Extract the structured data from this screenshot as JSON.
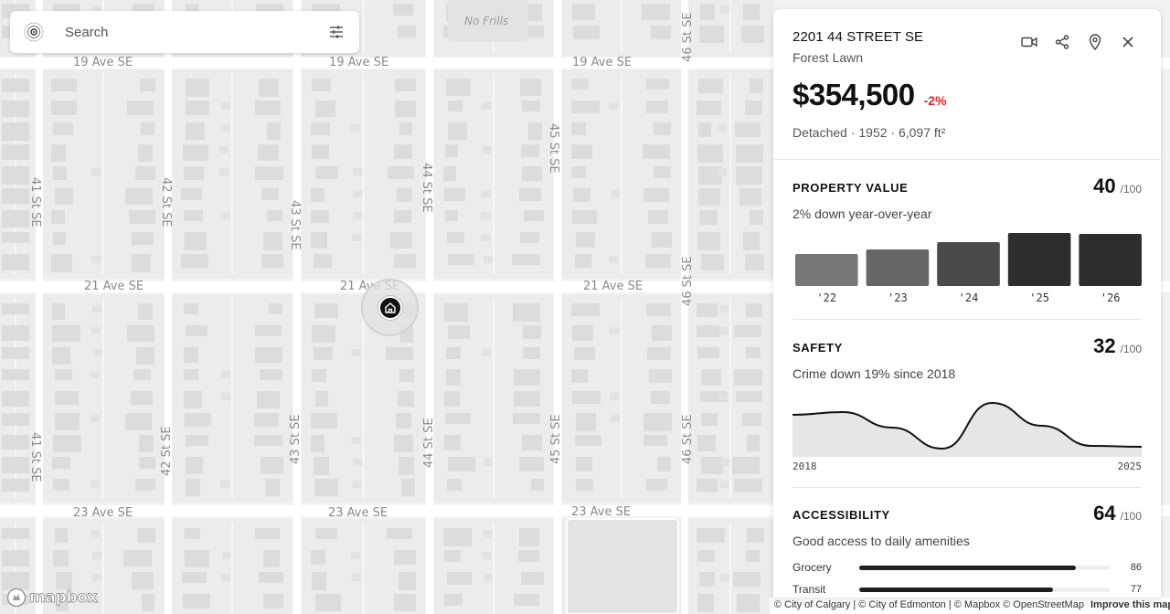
{
  "map": {
    "street_labels": [
      "19 Ave SE",
      "21 Ave SE",
      "23 Ave SE",
      "41 St SE",
      "42 St SE",
      "43 St SE",
      "44 St SE",
      "45 St SE",
      "46 St SE"
    ],
    "poi": "No Frills"
  },
  "search": {
    "placeholder": "Search"
  },
  "property": {
    "address": "2201 44 STREET SE",
    "neighbourhood": "Forest Lawn",
    "price": "$354,500",
    "change": "-2%",
    "details": "Detached · 1952 · 6,097 ft²"
  },
  "header_icons": [
    "video-icon",
    "share-icon",
    "location-pin-icon",
    "close-icon"
  ],
  "property_value": {
    "title": "PROPERTY VALUE",
    "score": "40",
    "denominator": "/100",
    "subtitle": "2% down year-over-year"
  },
  "safety": {
    "title": "SAFETY",
    "score": "32",
    "denominator": "/100",
    "subtitle": "Crime down 19% since 2018",
    "x_start": "2018",
    "x_end": "2025"
  },
  "accessibility": {
    "title": "ACCESSIBILITY",
    "score": "64",
    "denominator": "/100",
    "subtitle": "Good access to daily amenities",
    "items": [
      {
        "label": "Grocery",
        "value": 86
      },
      {
        "label": "Transit",
        "value": 77
      }
    ]
  },
  "chart_data": [
    {
      "type": "bar",
      "categories": [
        "'22",
        "'23",
        "'24",
        "'25",
        "'26"
      ],
      "values": [
        35,
        40,
        48,
        58,
        57
      ],
      "colors": [
        "#777777",
        "#666666",
        "#4a4a4a",
        "#2d2d2d",
        "#2d2d2d"
      ]
    },
    {
      "type": "area",
      "x": [
        2018,
        2019,
        2020,
        2021,
        2022,
        2023,
        2024,
        2025
      ],
      "values": [
        42,
        45,
        28,
        5,
        55,
        30,
        8,
        7
      ]
    }
  ],
  "attribution": {
    "text": "© City of Calgary | © City of Edmonton | © Mapbox © OpenStreetMap",
    "link": "Improve this map"
  },
  "logo": "mapbox",
  "colors": {
    "accent_negative": "#e02424",
    "bar_dark": "#2d2d2d",
    "map_bg": "#f2f2f2"
  }
}
